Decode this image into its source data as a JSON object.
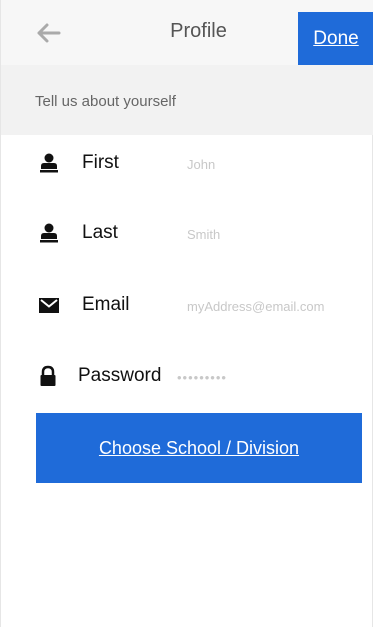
{
  "navbar": {
    "back_icon": "arrow-left-icon",
    "title": "Profile",
    "done_label": "Done"
  },
  "section": {
    "header": "Tell us about yourself"
  },
  "form": {
    "first": {
      "label": "First",
      "placeholder": "John",
      "icon": "person-icon"
    },
    "last": {
      "label": "Last",
      "placeholder": "Smith",
      "icon": "person-icon"
    },
    "email": {
      "label": "Email",
      "placeholder": "myAddress@email.com",
      "icon": "envelope-icon"
    },
    "password": {
      "label": "Password",
      "placeholder": "•••••••••",
      "icon": "lock-icon"
    }
  },
  "actions": {
    "choose_school_label": "Choose School / Division"
  },
  "colors": {
    "accent": "#1f6bd9",
    "nav_bg": "#f7f7f7",
    "section_bg": "#f2f2f2"
  }
}
